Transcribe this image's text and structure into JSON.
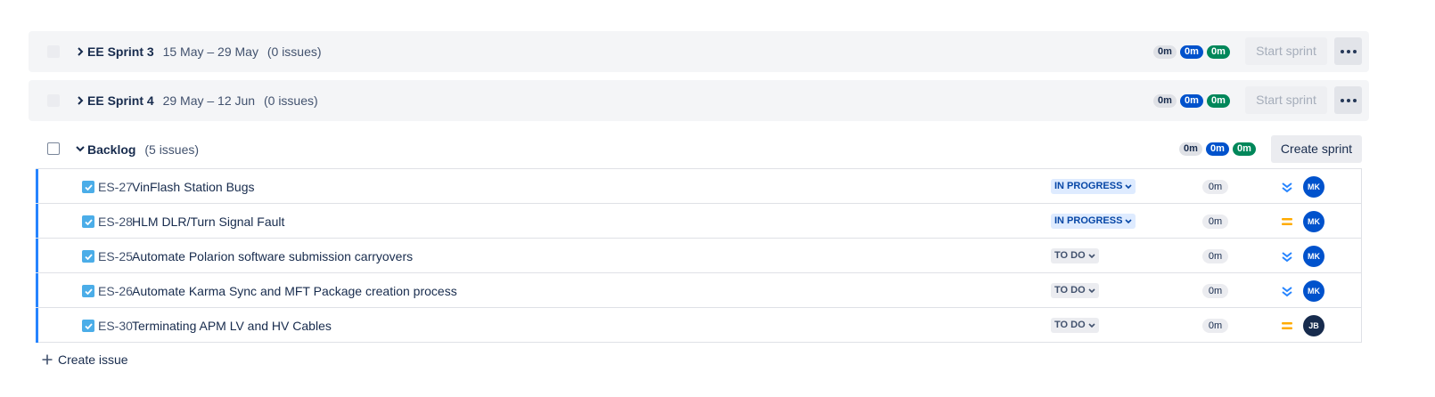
{
  "sprints": [
    {
      "name": "EE Sprint 3",
      "dates": "15 May – 29 May",
      "count": "(0 issues)",
      "estimates": {
        "todo": "0m",
        "in_progress": "0m",
        "done": "0m"
      },
      "start_label": "Start sprint"
    },
    {
      "name": "EE Sprint 4",
      "dates": "29 May – 12 Jun",
      "count": "(0 issues)",
      "estimates": {
        "todo": "0m",
        "in_progress": "0m",
        "done": "0m"
      },
      "start_label": "Start sprint"
    }
  ],
  "backlog": {
    "name": "Backlog",
    "count": "(5 issues)",
    "estimates": {
      "todo": "0m",
      "in_progress": "0m",
      "done": "0m"
    },
    "create_sprint_label": "Create sprint"
  },
  "issues": [
    {
      "key": "ES-27",
      "summary": "VinFlash Station Bugs",
      "status": "IN PROGRESS",
      "estimate": "0m",
      "priority": "lowest-icon",
      "assignee": "MK"
    },
    {
      "key": "ES-28",
      "summary": "HLM DLR/Turn Signal Fault",
      "status": "IN PROGRESS",
      "estimate": "0m",
      "priority": "medium-icon",
      "assignee": "MK"
    },
    {
      "key": "ES-25",
      "summary": "Automate Polarion software submission carryovers",
      "status": "TO DO",
      "estimate": "0m",
      "priority": "lowest-icon",
      "assignee": "MK"
    },
    {
      "key": "ES-26",
      "summary": "Automate Karma Sync and MFT Package creation process",
      "status": "TO DO",
      "estimate": "0m",
      "priority": "lowest-icon",
      "assignee": "MK"
    },
    {
      "key": "ES-30",
      "summary": "Terminating APM LV and HV Cables",
      "status": "TO DO",
      "estimate": "0m",
      "priority": "medium-icon",
      "assignee": "JB"
    }
  ],
  "create_issue_label": "Create issue",
  "colors": {
    "in_progress_badge": "#deebff",
    "todo_badge": "#ebecf0",
    "estimate_blue": "#0052cc",
    "estimate_green": "#00875a",
    "avatar_mk": "#0052cc",
    "avatar_jb": "#172b4d",
    "priority_lowest": "#2684ff",
    "priority_medium": "#ffab00"
  }
}
